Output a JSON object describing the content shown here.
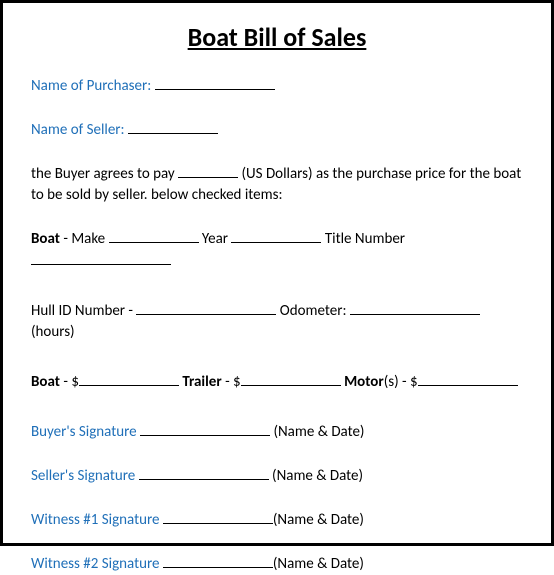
{
  "title": "Boat Bill of Sales",
  "purchaser": {
    "label": "Name of Purchaser:"
  },
  "seller": {
    "label": "Name of Seller:"
  },
  "agreement": {
    "pre": "the Buyer agrees to pay ",
    "mid": " (US Dollars) as the purchase price for the boat to be sold by seller. below checked items:"
  },
  "boat_line": {
    "boat": "Boat",
    "make": " - Make ",
    "year": " Year ",
    "title_num": " Title Number "
  },
  "hull_line": {
    "label": "Hull ID Number - ",
    "odo_label": " Odometer: ",
    "hours": " (hours)"
  },
  "price_line": {
    "boat": "Boat",
    "boat_sep": " - $",
    "trailer": "Trailer",
    "trailer_sep": " - $",
    "motor": "Motor",
    "motor_suffix": "(s) - $"
  },
  "sig": {
    "buyer": "Buyer's Signature ",
    "seller": "Seller's Signature ",
    "w1": "Witness #1 Signature ",
    "w2": "Witness #2 Signature ",
    "name_date": "(Name & Date)"
  }
}
